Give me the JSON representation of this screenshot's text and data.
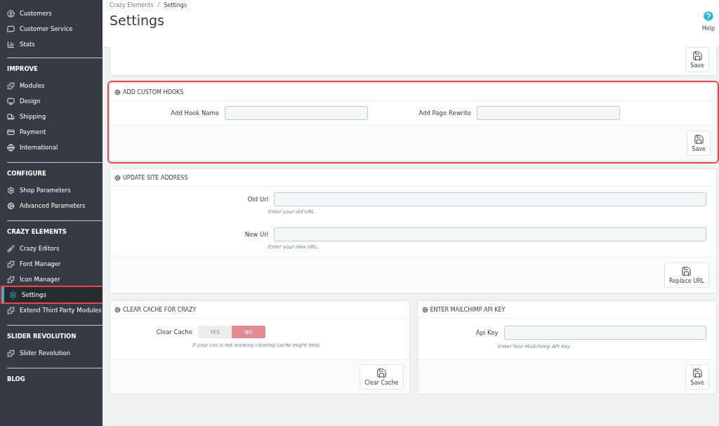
{
  "sidebar": {
    "sections": [
      {
        "items": [
          {
            "label": "Customers",
            "selected": false,
            "highlighted": false
          },
          {
            "label": "Customer Service",
            "selected": false,
            "highlighted": false
          },
          {
            "label": "Stats",
            "selected": false,
            "highlighted": false
          }
        ]
      },
      {
        "title": "IMPROVE",
        "items": [
          {
            "label": "Modules",
            "selected": false,
            "highlighted": false
          },
          {
            "label": "Design",
            "selected": false,
            "highlighted": false
          },
          {
            "label": "Shipping",
            "selected": false,
            "highlighted": false
          },
          {
            "label": "Payment",
            "selected": false,
            "highlighted": false
          },
          {
            "label": "International",
            "selected": false,
            "highlighted": false
          }
        ]
      },
      {
        "title": "CONFIGURE",
        "items": [
          {
            "label": "Shop Parameters",
            "selected": false,
            "highlighted": false
          },
          {
            "label": "Advanced Parameters",
            "selected": false,
            "highlighted": false
          }
        ]
      },
      {
        "title": "CRAZY ELEMENTS",
        "items": [
          {
            "label": "Crazy Editors",
            "selected": false,
            "highlighted": false
          },
          {
            "label": "Font Manager",
            "selected": false,
            "highlighted": false
          },
          {
            "label": "Icon Manager",
            "selected": false,
            "highlighted": false
          },
          {
            "label": "Settings",
            "selected": true,
            "highlighted": true
          },
          {
            "label": "Extend Third Party Modules",
            "selected": false,
            "highlighted": false
          }
        ]
      },
      {
        "title": "SLIDER REVOLUTION",
        "items": [
          {
            "label": "Slider Revolution",
            "selected": false,
            "highlighted": false
          }
        ]
      },
      {
        "title": "BLOG"
      }
    ]
  },
  "header": {
    "breadcrumb": [
      "Crazy Elements",
      "Settings"
    ],
    "separator": "/",
    "title": "Settings",
    "help": "Help"
  },
  "top_panel": {
    "button": "Save"
  },
  "hooks_panel": {
    "title": "ADD CUSTOM HOOKS",
    "highlighted": true,
    "fields": [
      {
        "label": "Add Hook Name"
      },
      {
        "label": "Add Page Rewrite"
      }
    ],
    "button": "Save"
  },
  "site_panel": {
    "title": "UPDATE SITE ADDRESS",
    "fields": [
      {
        "label": "Old Url",
        "hint": "Enter your old URL."
      },
      {
        "label": "New Url",
        "hint": "Enter your new URL."
      }
    ],
    "button": "Replace URL"
  },
  "cache_panel": {
    "title": "CLEAR CACHE FOR CRAZY",
    "label": "Clear Cache",
    "options": [
      {
        "label": "YES",
        "selected": false
      },
      {
        "label": "NO",
        "selected": true
      }
    ],
    "hint": "If your css is not working clearing cache might help.",
    "button": "Clear Cache"
  },
  "mailchimp_panel": {
    "title": "ENTER MAILCHIMP API KEY",
    "label": "Api Key",
    "hint": "Enter Your Mailchimp API Key.",
    "button": "Save"
  }
}
